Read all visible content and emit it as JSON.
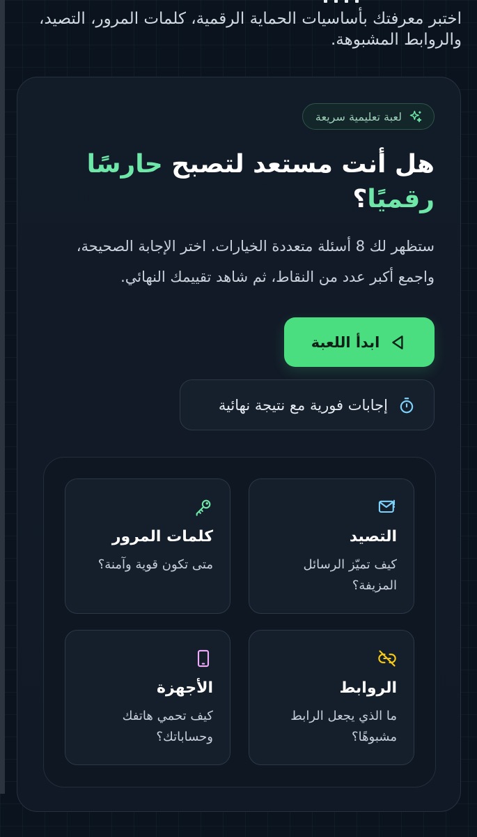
{
  "intro_text": "اختبر معرفتك بأساسيات الحماية الرقمية، كلمات المرور، التصيد، والروابط المشبوهة.",
  "badge": {
    "label": "لعبة تعليمية سريعة",
    "icon": "sparkles-icon"
  },
  "heading": {
    "part1": "هل أنت مستعد لتصبح ",
    "accent": "حارسًا رقميًا",
    "part2": "؟"
  },
  "description": "ستظهر لك 8 أسئلة متعددة الخيارات. اختر الإجابة الصحيحة، واجمع أكبر عدد من النقاط، ثم شاهد تقييمك النهائي.",
  "start_button": {
    "label": "ابدأ اللعبة",
    "icon": "play-icon"
  },
  "info_pill": {
    "label": "إجابات فورية مع نتيجة نهائية",
    "icon": "stopwatch-icon"
  },
  "topics": [
    {
      "title": "التصيد",
      "desc": "كيف تميّز الرسائل المزيفة؟",
      "icon": "mail-alert-icon"
    },
    {
      "title": "كلمات المرور",
      "desc": "متى تكون قوية وآمنة؟",
      "icon": "key-icon"
    },
    {
      "title": "الروابط",
      "desc": "ما الذي يجعل الرابط مشبوهًا؟",
      "icon": "broken-link-icon"
    },
    {
      "title": "الأجهزة",
      "desc": "كيف تحمي هاتفك وحساباتك؟",
      "icon": "phone-icon"
    }
  ],
  "colors": {
    "accent": "#6ee7a8",
    "button": "#4ade80",
    "icon_mail": "#7dd3fc",
    "icon_key": "#6ee7a8",
    "icon_link": "#facc15",
    "icon_phone": "#f0abfc",
    "icon_timer": "#7dd3fc"
  }
}
